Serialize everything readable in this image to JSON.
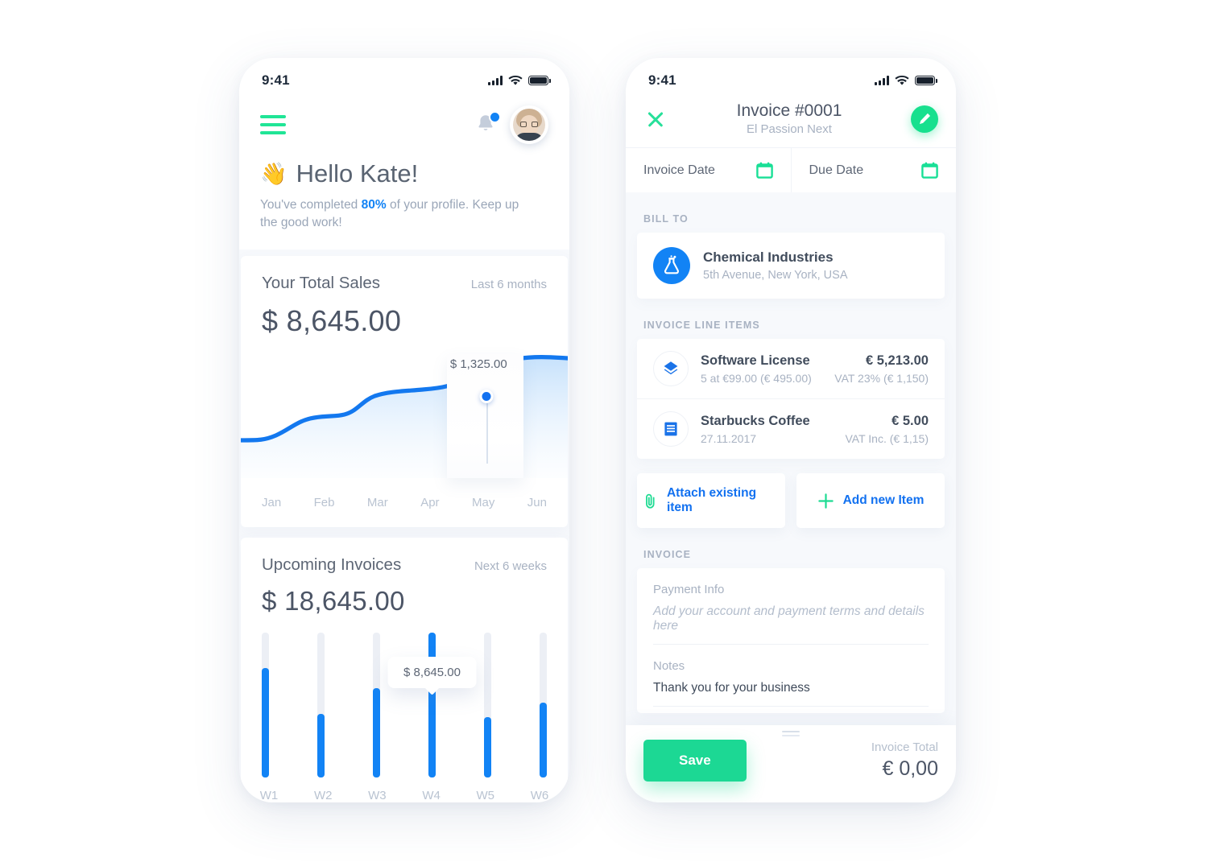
{
  "left_phone": {
    "status_bar": {
      "time": "9:41"
    },
    "header": {
      "greeting": "Hello Kate!",
      "wave_emoji": "👋",
      "profile_text_before": "You've completed ",
      "profile_percent": "80%",
      "profile_text_after": " of your profile. Keep up the good work!"
    },
    "sales_card": {
      "title": "Your Total Sales",
      "range": "Last 6 months",
      "amount": "$ 8,645.00",
      "tooltip": "$ 1,325.00"
    },
    "invoices_card": {
      "title": "Upcoming Invoices",
      "range": "Next 6 weeks",
      "amount": "$ 18,645.00",
      "tooltip": "$ 8,645.00"
    }
  },
  "right_phone": {
    "status_bar": {
      "time": "9:41"
    },
    "header": {
      "title": "Invoice #0001",
      "subtitle": "El Passion Next"
    },
    "dates": {
      "invoice_date_label": "Invoice Date",
      "due_date_label": "Due Date"
    },
    "bill_to": {
      "section_label": "BILL TO",
      "company": "Chemical Industries",
      "address": "5th Avenue, New York, USA"
    },
    "line_items": {
      "section_label": "INVOICE LINE ITEMS",
      "items": [
        {
          "name": "Software License",
          "desc": "5 at €99.00 (€ 495.00)",
          "amount": "€ 5,213.00",
          "vat": "VAT 23% (€ 1,150)",
          "icon": "layers-icon"
        },
        {
          "name": "Starbucks Coffee",
          "desc": "27.11.2017",
          "amount": "€ 5.00",
          "vat": "VAT Inc. (€ 1,15)",
          "icon": "receipt-icon"
        }
      ]
    },
    "actions": {
      "attach_label": "Attach existing item",
      "add_label": "Add new Item"
    },
    "invoice_form": {
      "section_label": "INVOICE",
      "payment_info_label": "Payment Info",
      "payment_info_placeholder": "Add your account and payment terms and details here",
      "notes_label": "Notes",
      "notes_value": "Thank you for your business"
    },
    "bottom": {
      "save_label": "Save",
      "total_label": "Invoice Total",
      "total_value": "€ 0,00"
    }
  },
  "colors": {
    "accent_green": "#20e596",
    "accent_blue": "#1283f5",
    "text_dark": "#4c5566",
    "text_muted": "#a8b2c2",
    "bg": "#f7f9fc"
  },
  "chart_data": [
    {
      "type": "line",
      "title": "Your Total Sales",
      "subtitle": "Last 6 months",
      "total": "$ 8,645.00",
      "categories": [
        "Jan",
        "Feb",
        "Mar",
        "Apr",
        "May",
        "Jun"
      ],
      "values": [
        620,
        880,
        1020,
        1120,
        1325,
        1480
      ],
      "highlight_category": "May",
      "highlight_value": "$ 1,325.00",
      "xlabel": "",
      "ylabel": "",
      "grid": false,
      "legend": "none",
      "area_fill": true
    },
    {
      "type": "bar",
      "title": "Upcoming Invoices",
      "subtitle": "Next 6 weeks",
      "total": "$ 18,645.00",
      "categories": [
        "W1",
        "W2",
        "W3",
        "W4",
        "W5",
        "W6"
      ],
      "values": [
        76,
        44,
        62,
        100,
        42,
        52
      ],
      "highlight_category": "W4",
      "highlight_value": "$ 8,645.00",
      "xlabel": "",
      "ylabel": "",
      "ylim": [
        0,
        100
      ],
      "grid": false,
      "legend": "none"
    }
  ]
}
